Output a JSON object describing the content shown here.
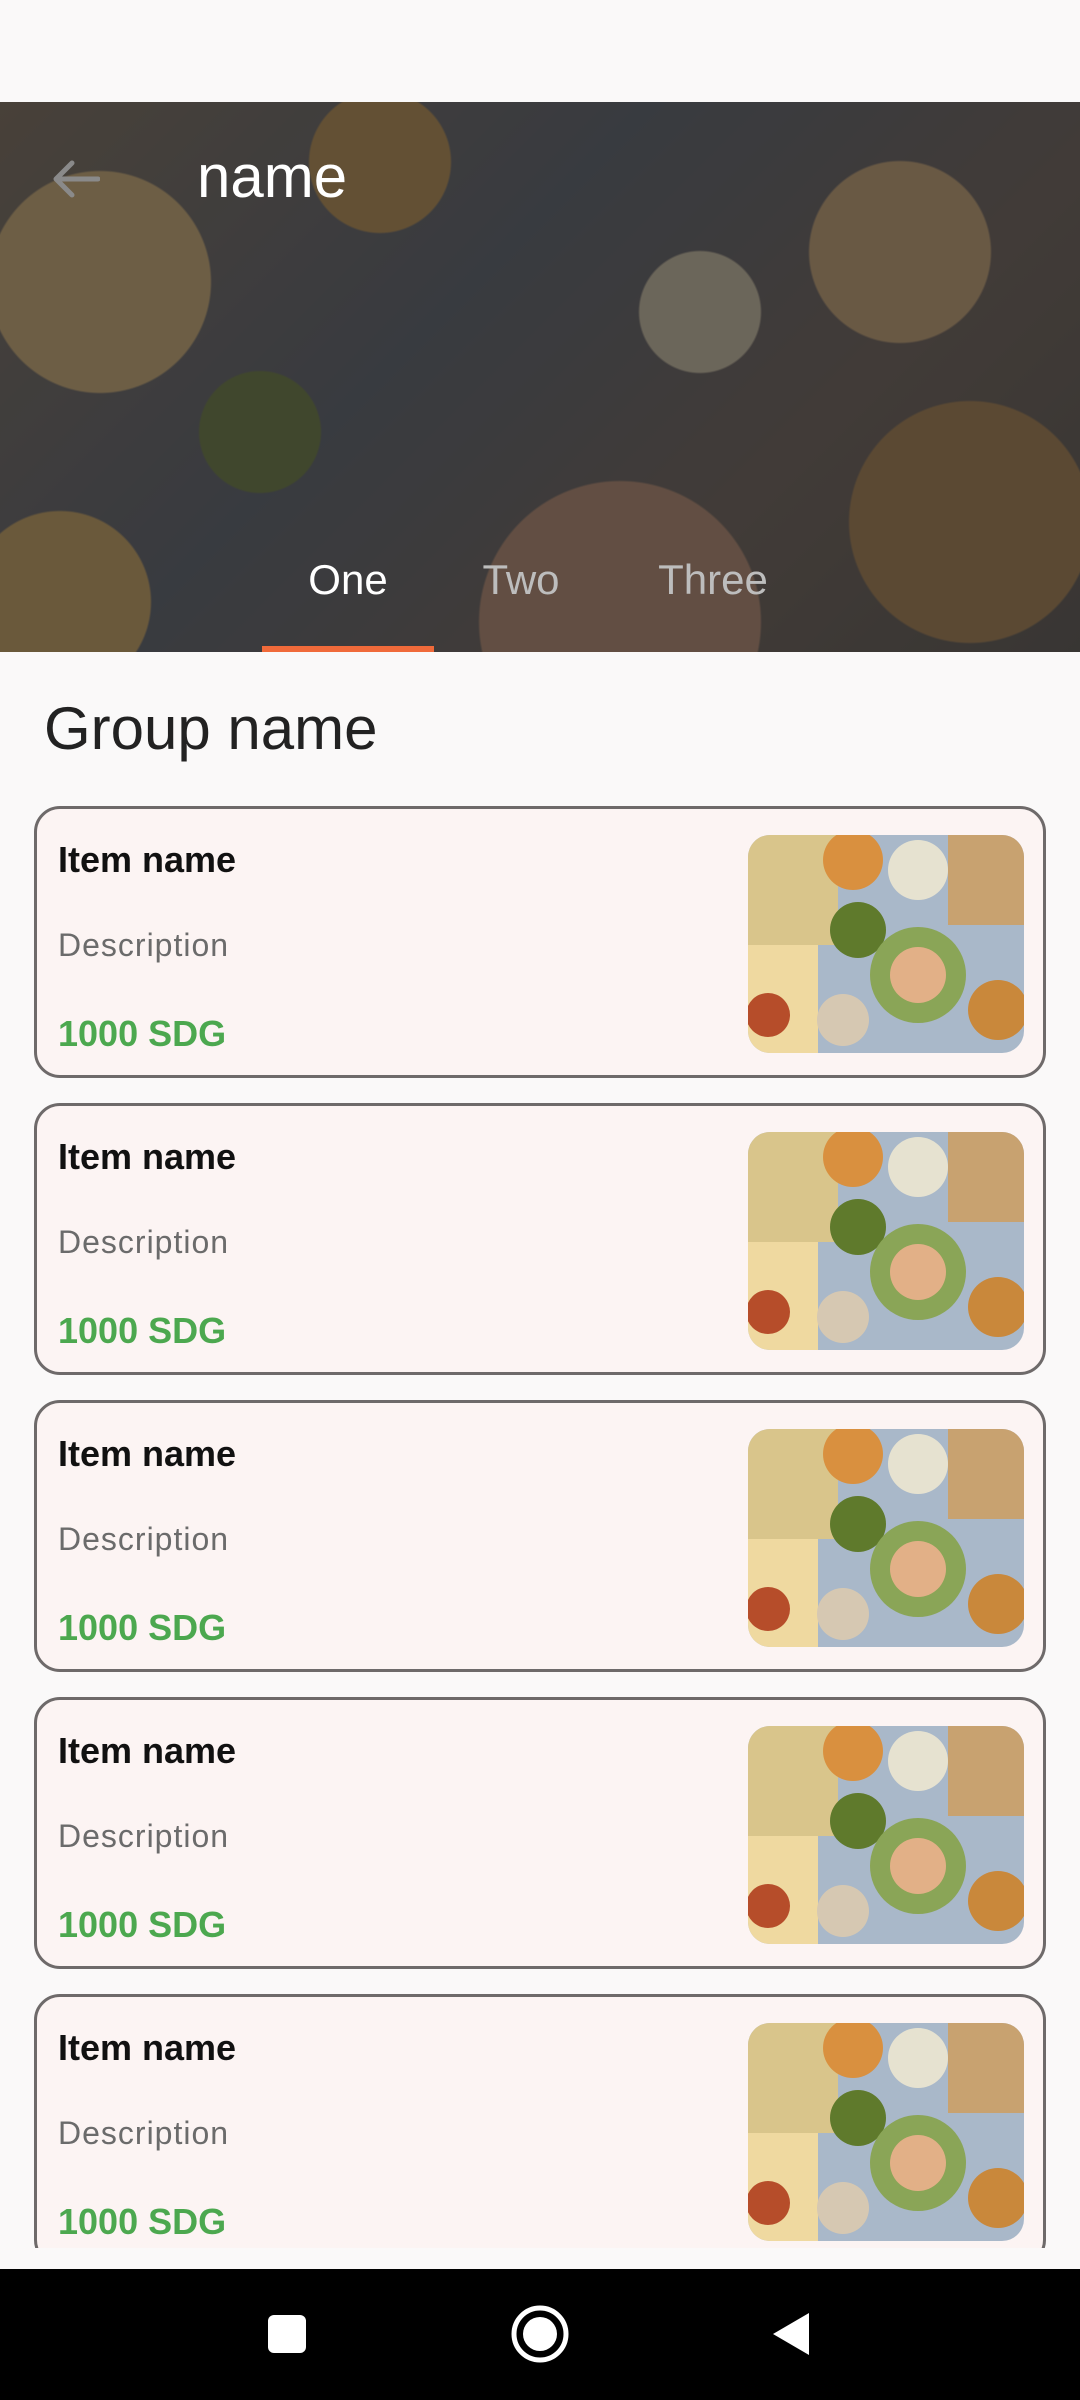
{
  "header": {
    "title": "name",
    "back_icon": "arrow-left-icon",
    "tabs": [
      {
        "label": "One",
        "selected": true
      },
      {
        "label": "Two",
        "selected": false
      },
      {
        "label": "Three",
        "selected": false
      }
    ],
    "accent_color": "#f06a3a"
  },
  "group": {
    "name": "Group name"
  },
  "items": [
    {
      "name": "Item name",
      "description": "Description",
      "price": "1000 SDG"
    },
    {
      "name": "Item name",
      "description": "Description",
      "price": "1000 SDG"
    },
    {
      "name": "Item name",
      "description": "Description",
      "price": "1000 SDG"
    },
    {
      "name": "Item name",
      "description": "Description",
      "price": "1000 SDG"
    },
    {
      "name": "Item name",
      "description": "Description",
      "price": "1000 SDG"
    }
  ],
  "nav": {
    "icons": [
      "recents-square-icon",
      "home-circle-icon",
      "back-triangle-icon"
    ]
  },
  "colors": {
    "price": "#4ca84f",
    "card_border": "#6e6a6a",
    "card_bg": "#fcf4f3"
  }
}
